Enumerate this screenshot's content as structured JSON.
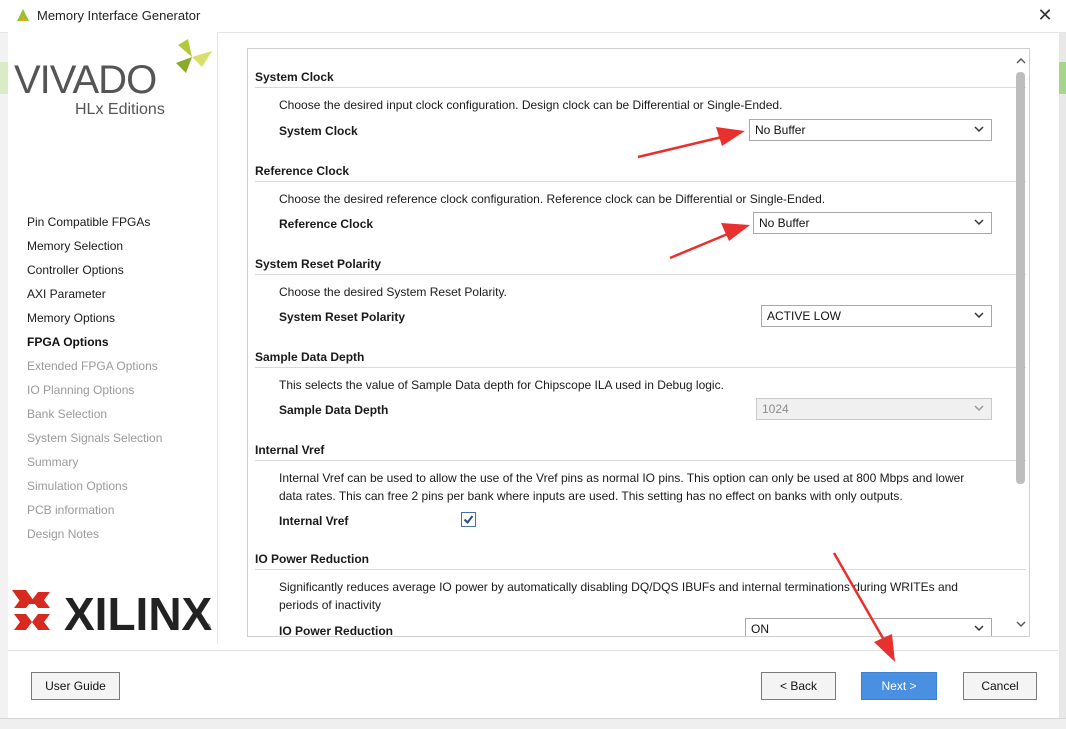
{
  "window": {
    "title": "Memory Interface Generator",
    "close_label": "✕"
  },
  "branding": {
    "vivado": "VIVADO",
    "vivado_edition": "HLx Editions",
    "xilinx": "XILINX",
    "registered": "®"
  },
  "nav": [
    {
      "label": "Pin Compatible FPGAs",
      "state": "active"
    },
    {
      "label": "Memory Selection",
      "state": "active"
    },
    {
      "label": "Controller Options",
      "state": "active"
    },
    {
      "label": "AXI Parameter",
      "state": "active"
    },
    {
      "label": "Memory Options",
      "state": "active"
    },
    {
      "label": "FPGA Options",
      "state": "current"
    },
    {
      "label": "Extended FPGA Options",
      "state": "disabled"
    },
    {
      "label": "IO Planning Options",
      "state": "disabled"
    },
    {
      "label": "Bank Selection",
      "state": "disabled"
    },
    {
      "label": "System Signals Selection",
      "state": "disabled"
    },
    {
      "label": "Summary",
      "state": "disabled"
    },
    {
      "label": "Simulation Options",
      "state": "disabled"
    },
    {
      "label": "PCB information",
      "state": "disabled"
    },
    {
      "label": "Design Notes",
      "state": "disabled"
    }
  ],
  "sections": {
    "system_clock": {
      "title": "System Clock",
      "description": "Choose the desired input clock configuration. Design clock can be Differential or Single-Ended.",
      "label": "System Clock",
      "value": "No Buffer"
    },
    "reference_clock": {
      "title": "Reference Clock",
      "description": "Choose the desired reference clock configuration. Reference clock can be Differential or Single-Ended.",
      "label": "Reference Clock",
      "value": "No Buffer"
    },
    "reset_polarity": {
      "title": "System Reset Polarity",
      "description": "Choose the desired System Reset Polarity.",
      "label": "System Reset Polarity",
      "value": "ACTIVE LOW"
    },
    "sample_depth": {
      "title": "Sample Data Depth",
      "description": "This selects the value of Sample Data depth for Chipscope ILA used in Debug logic.",
      "label": "Sample Data Depth",
      "value": "1024"
    },
    "internal_vref": {
      "title": "Internal Vref",
      "description_line1": "Internal Vref can be used to allow the use of the Vref pins as normal IO pins. This option can only be used at 800 Mbps and lower",
      "description_line2": "data rates. This can free 2 pins per bank where inputs are used. This setting has no effect on banks with only outputs.",
      "label": "Internal Vref",
      "checked": true
    },
    "io_power": {
      "title": "IO Power Reduction",
      "description_line1": "Significantly reduces average IO power by automatically disabling DQ/DQS IBUFs and internal terminations during WRITEs and",
      "description_line2": "periods of inactivity",
      "label": "IO Power Reduction",
      "value": "ON"
    }
  },
  "buttons": {
    "user_guide": "User Guide",
    "back": "< Back",
    "next": "Next >",
    "cancel": "Cancel"
  },
  "colors": {
    "accent": "#4a90e2",
    "annotation": "#e8312f"
  }
}
